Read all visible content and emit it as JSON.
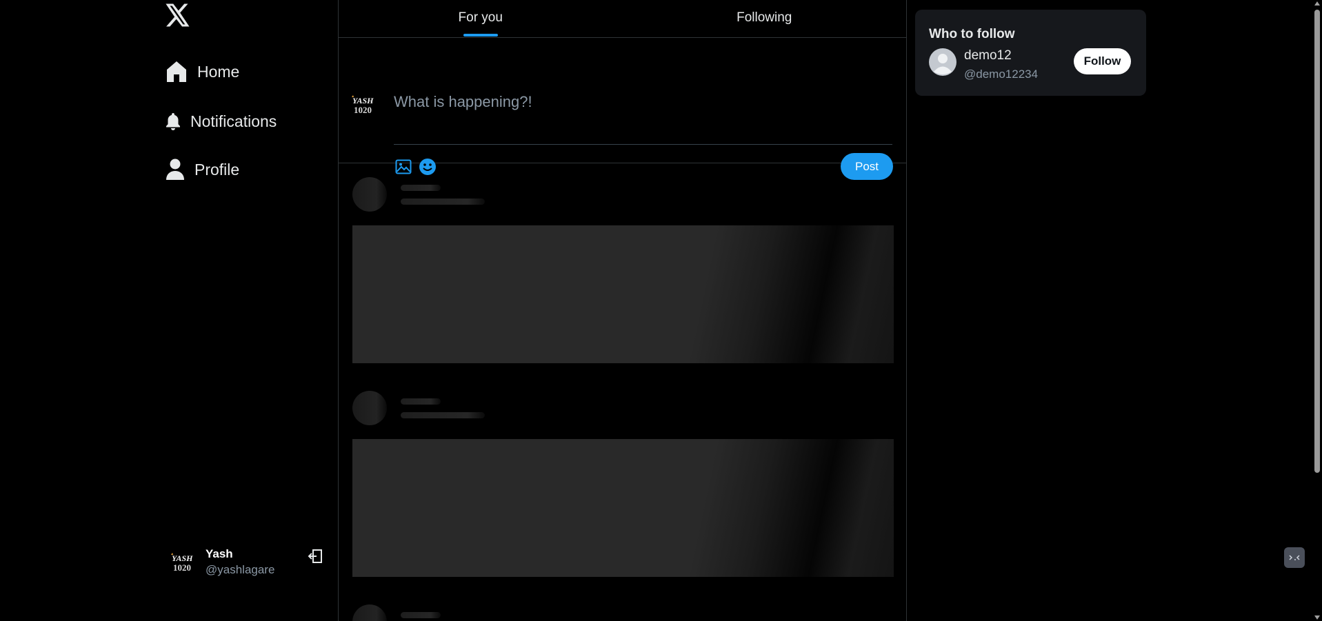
{
  "nav": {
    "items": [
      {
        "label": "Home",
        "icon": "home-icon"
      },
      {
        "label": "Notifications",
        "icon": "bell-icon"
      },
      {
        "label": "Profile",
        "icon": "user-icon"
      }
    ]
  },
  "account": {
    "name": "Yash",
    "handle": "@yashlagare",
    "avatar_text": "YASH"
  },
  "tabs": [
    {
      "label": "For you",
      "active": true
    },
    {
      "label": "Following",
      "active": false
    }
  ],
  "composer": {
    "placeholder": "What is happening?!",
    "avatar_text": "YASH",
    "post_label": "Post"
  },
  "who_to_follow": {
    "title": "Who to follow",
    "users": [
      {
        "name": "demo12",
        "handle": "@demo12234",
        "button": "Follow"
      }
    ]
  },
  "colors": {
    "accent": "#1d9bf0",
    "background": "#000000",
    "card": "#16181c",
    "muted_text": "#8b98a5"
  }
}
